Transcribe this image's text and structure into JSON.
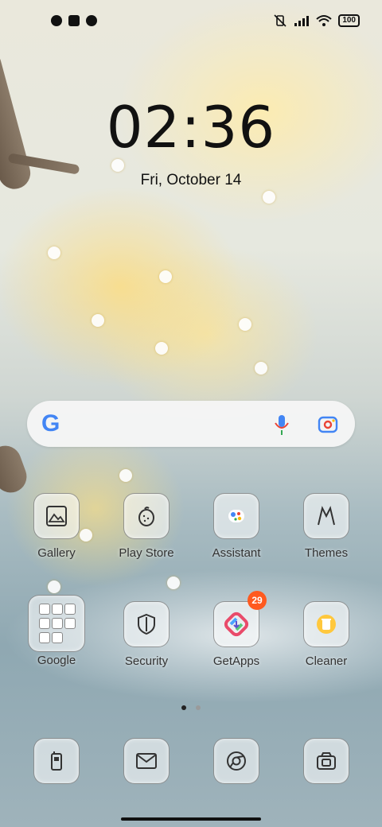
{
  "status_bar": {
    "battery": "100"
  },
  "lock": {
    "time": "02:36",
    "date": "Fri, October 14"
  },
  "search": {
    "logo": "G"
  },
  "apps_row1": [
    {
      "label": "Gallery",
      "icon": "gallery-icon"
    },
    {
      "label": "Play Store",
      "icon": "play-store-icon"
    },
    {
      "label": "Assistant",
      "icon": "assistant-icon"
    },
    {
      "label": "Themes",
      "icon": "themes-icon"
    }
  ],
  "apps_row2": [
    {
      "label": "Google",
      "icon": "google-folder-icon"
    },
    {
      "label": "Security",
      "icon": "shield-icon"
    },
    {
      "label": "GetApps",
      "icon": "getapps-icon",
      "badge": "29"
    },
    {
      "label": "Cleaner",
      "icon": "cleaner-icon"
    }
  ],
  "dock": [
    {
      "icon": "phone-icon"
    },
    {
      "icon": "messages-icon"
    },
    {
      "icon": "chrome-icon"
    },
    {
      "icon": "camera-icon"
    }
  ],
  "colors": {
    "badge": "#ff5a1f",
    "page_dot_active": "#222222",
    "page_dot_inactive": "#9a9a9a"
  }
}
